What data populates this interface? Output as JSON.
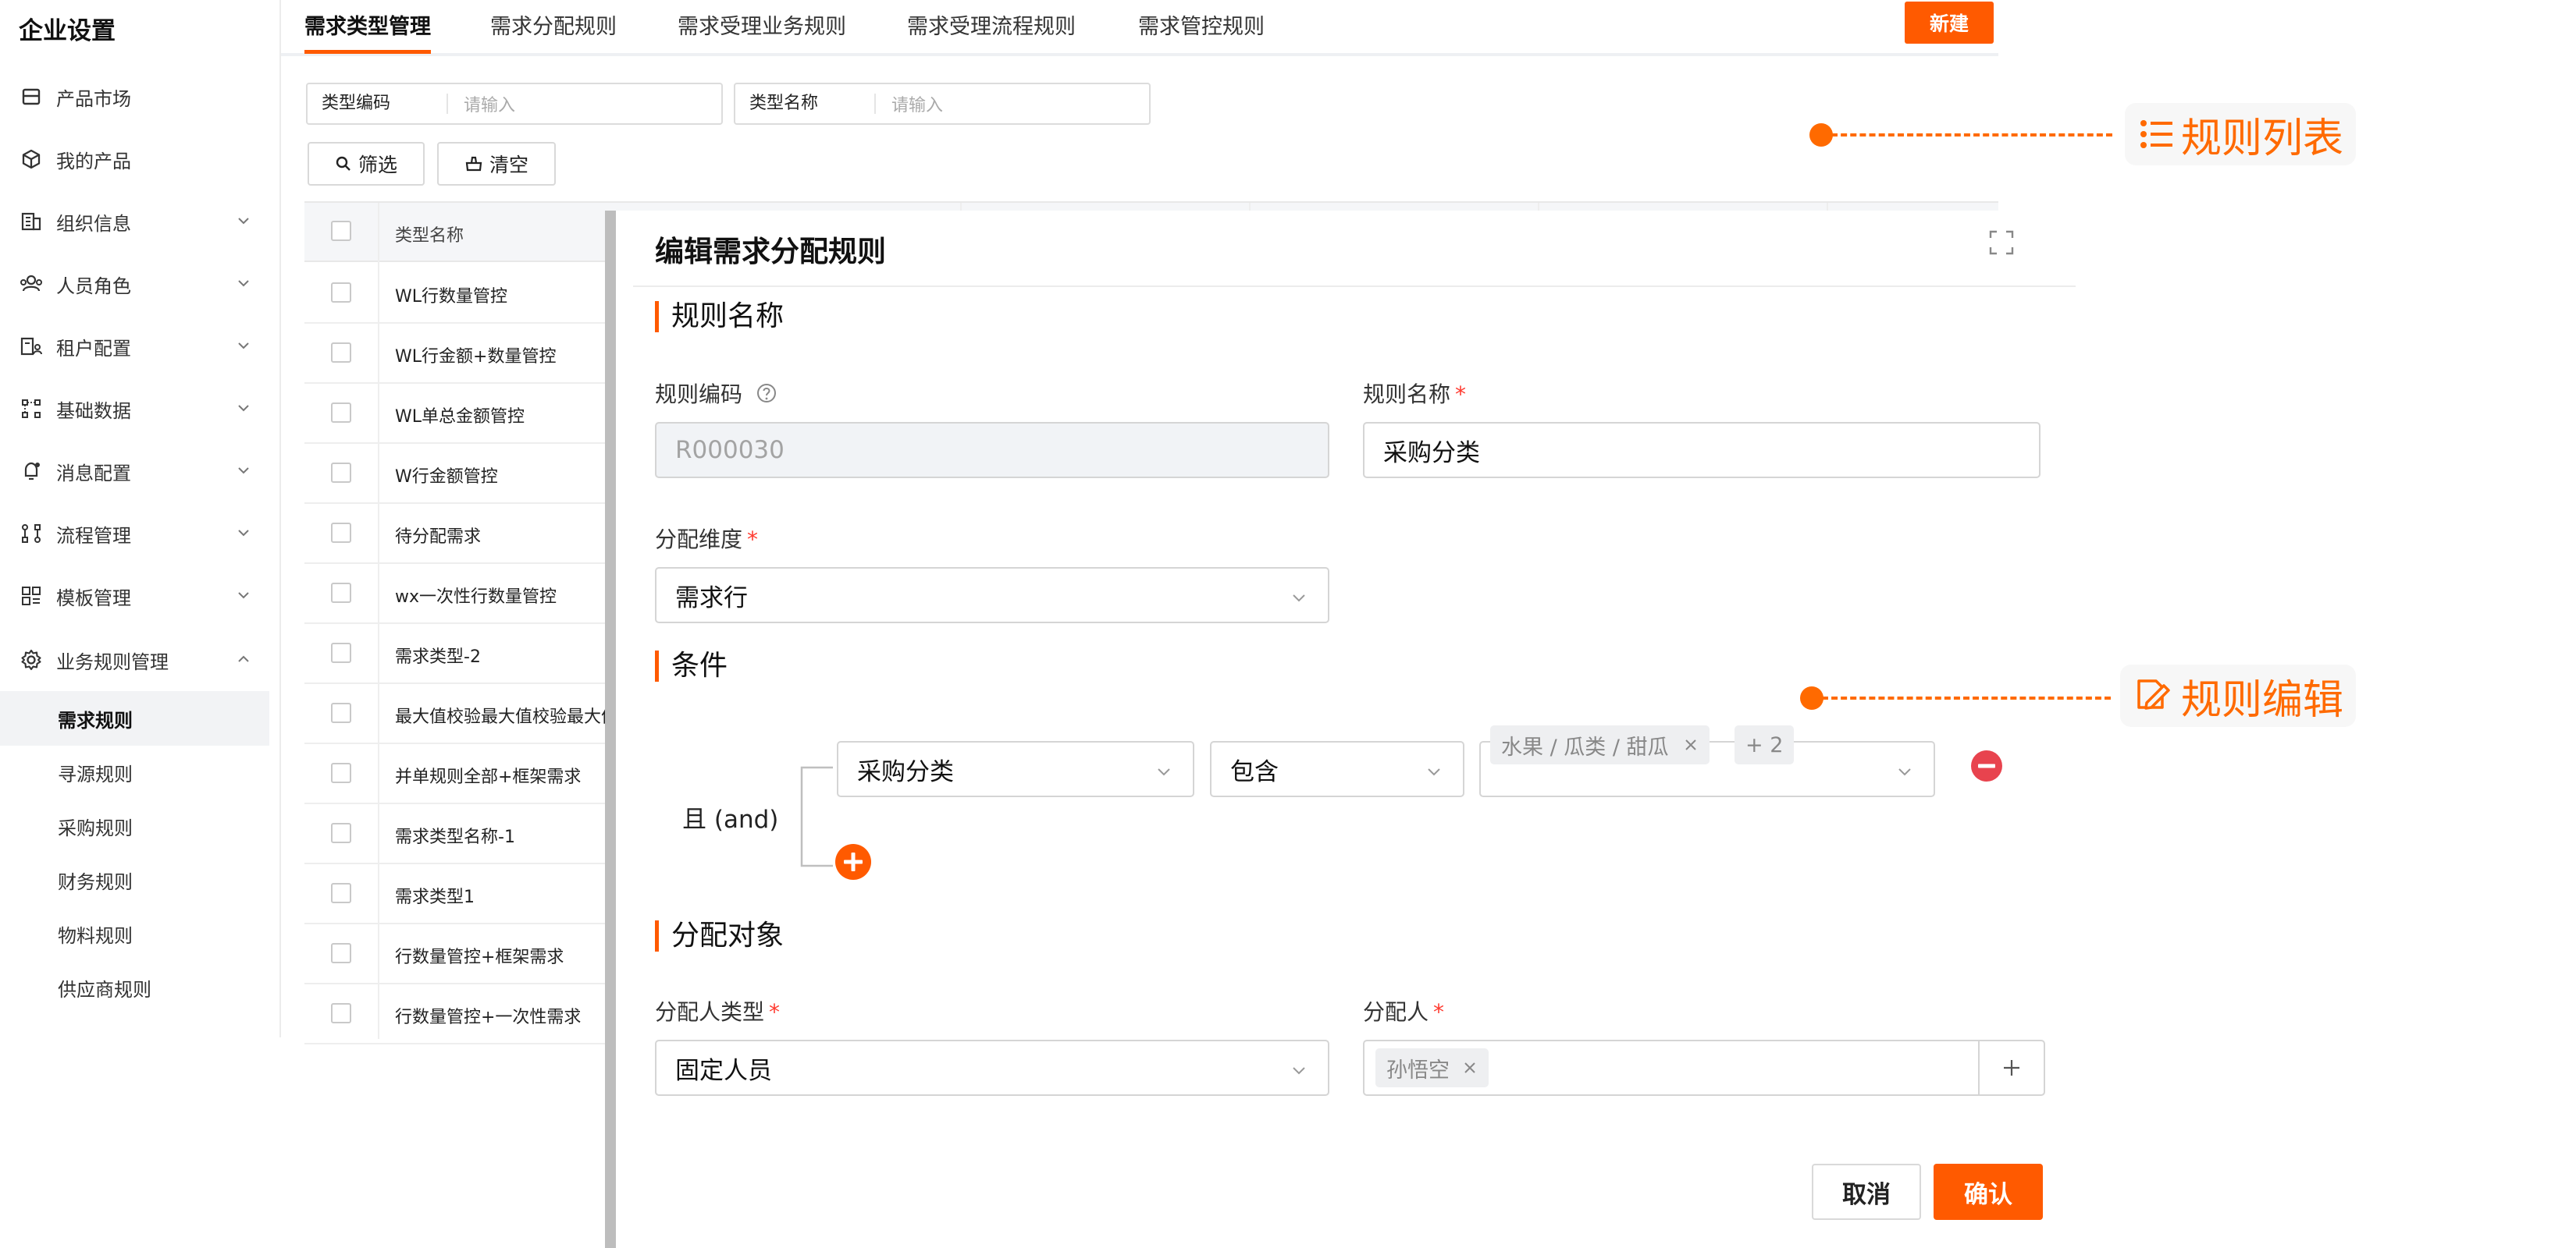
{
  "sidebar": {
    "title": "企业设置",
    "items": [
      {
        "label": "产品市场",
        "icon": "storefront-icon",
        "expandable": false
      },
      {
        "label": "我的产品",
        "icon": "cube-icon",
        "expandable": false
      },
      {
        "label": "组织信息",
        "icon": "building-icon",
        "expandable": true
      },
      {
        "label": "人员角色",
        "icon": "users-icon",
        "expandable": true
      },
      {
        "label": "租户配置",
        "icon": "tenant-icon",
        "expandable": true
      },
      {
        "label": "基础数据",
        "icon": "data-nodes-icon",
        "expandable": true
      },
      {
        "label": "消息配置",
        "icon": "bell-icon",
        "expandable": true
      },
      {
        "label": "流程管理",
        "icon": "flow-icon",
        "expandable": true
      },
      {
        "label": "模板管理",
        "icon": "template-icon",
        "expandable": true
      },
      {
        "label": "业务规则管理",
        "icon": "gear-icon",
        "expandable": true,
        "expanded": true
      }
    ],
    "subitems": [
      "需求规则",
      "寻源规则",
      "采购规则",
      "财务规则",
      "物料规则",
      "供应商规则"
    ],
    "active_subitem": "需求规则"
  },
  "tabs": [
    "需求类型管理",
    "需求分配规则",
    "需求受理业务规则",
    "需求受理流程规则",
    "需求管控规则"
  ],
  "active_tab": "需求类型管理",
  "new_button": "新建",
  "filters": [
    {
      "label": "类型编码",
      "placeholder": "请输入"
    },
    {
      "label": "类型名称",
      "placeholder": "请输入"
    }
  ],
  "filter_button": "筛选",
  "clear_button": "清空",
  "table": {
    "header": "类型名称",
    "rows": [
      "WL行数量管控",
      "WL行金额+数量管控",
      "WL单总金额管控",
      "W行金额管控",
      "待分配需求",
      "wx一次性行数量管控",
      "需求类型-2",
      "最大值校验最大值校验最大值",
      "并单规则全部+框架需求",
      "需求类型名称-1",
      "需求类型1",
      "行数量管控+框架需求",
      "行数量管控+一次性需求"
    ]
  },
  "modal": {
    "title": "编辑需求分配规则",
    "section_name": "规则名称",
    "rule_code_label": "规则编码",
    "rule_code_value": "R000030",
    "rule_name_label": "规则名称",
    "rule_name_value": "采购分类",
    "dimension_label": "分配维度",
    "dimension_value": "需求行",
    "section_condition": "条件",
    "logic_label": "且 (and)",
    "condition": {
      "field": "采购分类",
      "operator": "包含",
      "value_tag": "水果 / 瓜类 / 甜瓜",
      "more_tag": "+ 2"
    },
    "section_target": "分配对象",
    "assignee_type_label": "分配人类型",
    "assignee_type_value": "固定人员",
    "assignee_label": "分配人",
    "assignee_tag": "孙悟空",
    "cancel": "取消",
    "confirm": "确认"
  },
  "annotations": {
    "list": "规则列表",
    "edit": "规则编辑"
  },
  "colors": {
    "accent": "#ff5a00",
    "annotation": "#ff6a00",
    "danger": "#e8434e"
  }
}
